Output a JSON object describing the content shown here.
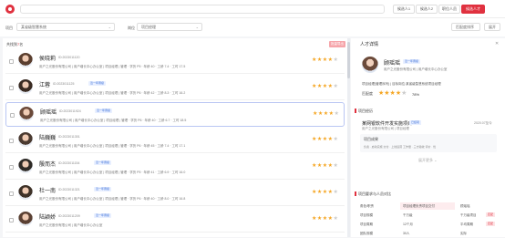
{
  "top": {
    "search_placeholder": "",
    "buttons": [
      {
        "label": "候选人1",
        "active": false
      },
      {
        "label": "候选人2",
        "active": false
      },
      {
        "label": "职位人员",
        "active": false
      },
      {
        "label": "候选人才",
        "active": true
      }
    ]
  },
  "filters": {
    "label1": "项目",
    "value1": "某省级智慧系统",
    "label2": "岗位",
    "value2": "项目经理",
    "sort": "匹配度排序",
    "more": "展开"
  },
  "list": {
    "header_prefix": "共找到",
    "header_count": "7",
    "header_suffix": "名",
    "export_label": "批量导出",
    "rows": [
      {
        "name": "侯晓莉",
        "id": "ID:2023011120",
        "tag": "",
        "company": "用户之光股份有限公司",
        "dept": "用户增长中心办公室",
        "field": "项目经理",
        "meta": "管理 · 学历 P5 · 年龄 40 · 工龄 7.4 · 工时 17.5",
        "stars": 4,
        "avatar": "#5a3e2e",
        "selected": false
      },
      {
        "name": "江蓉",
        "id": "ID:2023011125",
        "tag": "近一年晋级",
        "company": "用户之光股份有限公司",
        "dept": "用户增长中心办公室",
        "field": "项目经理",
        "meta": "管理 · 学历 P6 · 年龄 42 · 工龄 8.3 · 工时 16.2",
        "stars": 4,
        "avatar": "#3a2b22",
        "selected": false
      },
      {
        "name": "顾瑶瑶",
        "id": "ID:2023011924",
        "tag": "近一年晋级",
        "company": "用户之光股份有限公司",
        "dept": "用户增长中心办公室",
        "field": "项目经理",
        "meta": "管理 · 学历 P6 · 年龄 40 · 工龄 6.7 · 工时 18.5",
        "stars": 4,
        "avatar": "#6b4a3a",
        "selected": true
      },
      {
        "name": "陆巍巍",
        "id": "ID:2023011301",
        "tag": "",
        "company": "用户之光股份有限公司",
        "dept": "用户增长中心办公室",
        "field": "项目经理",
        "meta": "管理 · 学历 P6 · 年龄 45 · 工龄 7.4 · 工时 17.1",
        "stars": 4,
        "avatar": "#4a3a30",
        "selected": false
      },
      {
        "name": "殷而杰",
        "id": "ID:2023011154",
        "tag": "近一年晋级",
        "company": "用户之光股份有限公司",
        "dept": "用户增长中心办公室",
        "field": "项目经理",
        "meta": "管理 · 学历 P5 · 年龄 41 · 工龄 6.9 · 工时 16.0",
        "stars": 4,
        "avatar": "#2e2a26",
        "selected": false
      },
      {
        "name": "杜一南",
        "id": "ID:2023011321",
        "tag": "近一年晋级",
        "company": "用户之光股份有限公司",
        "dept": "用户增长中心办公室",
        "field": "项目经理",
        "meta": "管理 · 学历 P6 · 年龄 40 · 工龄 8.0 · 工时 16.8",
        "stars": 4,
        "avatar": "#3f3228",
        "selected": false
      },
      {
        "name": "陆颖娇",
        "id": "ID:2023011209",
        "tag": "近一年晋级",
        "company": "用户之光股份有限公司",
        "dept": "用户增长中心办公室",
        "field": "",
        "meta": "",
        "stars": 4,
        "avatar": "#5a4032",
        "selected": false
      }
    ]
  },
  "detail": {
    "title": "人才详情",
    "close": "✕",
    "name": "顾瑶瑶",
    "tag": "近一年晋级",
    "sub": "用户之光股份有限公司 | 用户增长中心办公室",
    "line1": "项目经理(管理序列) | 目标岗位:某省级智慧系统项目经理",
    "score_label": "匹配度",
    "stars": 4,
    "score_pct": "78%",
    "section1": "项目经历",
    "project_name": "某网银软件开发实施项目",
    "project_tag": "已结项",
    "project_date": "2020.07至今",
    "project_sub": "用户之光股份有限公司 | 项目经理",
    "achieve_title": "项目成果",
    "achieve_text": "负责 · 启动实施  交付 · 上线运营  工作量 · 三方验收  评价 · 优",
    "expand": "展开更多 ⌄",
    "section2": "项目要求与人员对比",
    "skills": [
      {
        "a": "角色/职责",
        "b": "项目经理负责项目交付",
        "c": "顾瑶瑶",
        "d": ""
      },
      {
        "a": "项目规模",
        "b": "千万级",
        "c": "千万级项目",
        "d": "匹配"
      },
      {
        "a": "项目周期",
        "b": "12个月",
        "c": "平均周期",
        "d": "匹配"
      },
      {
        "a": "团队规模",
        "b": "30人",
        "c": "实际",
        "d": ""
      }
    ]
  }
}
